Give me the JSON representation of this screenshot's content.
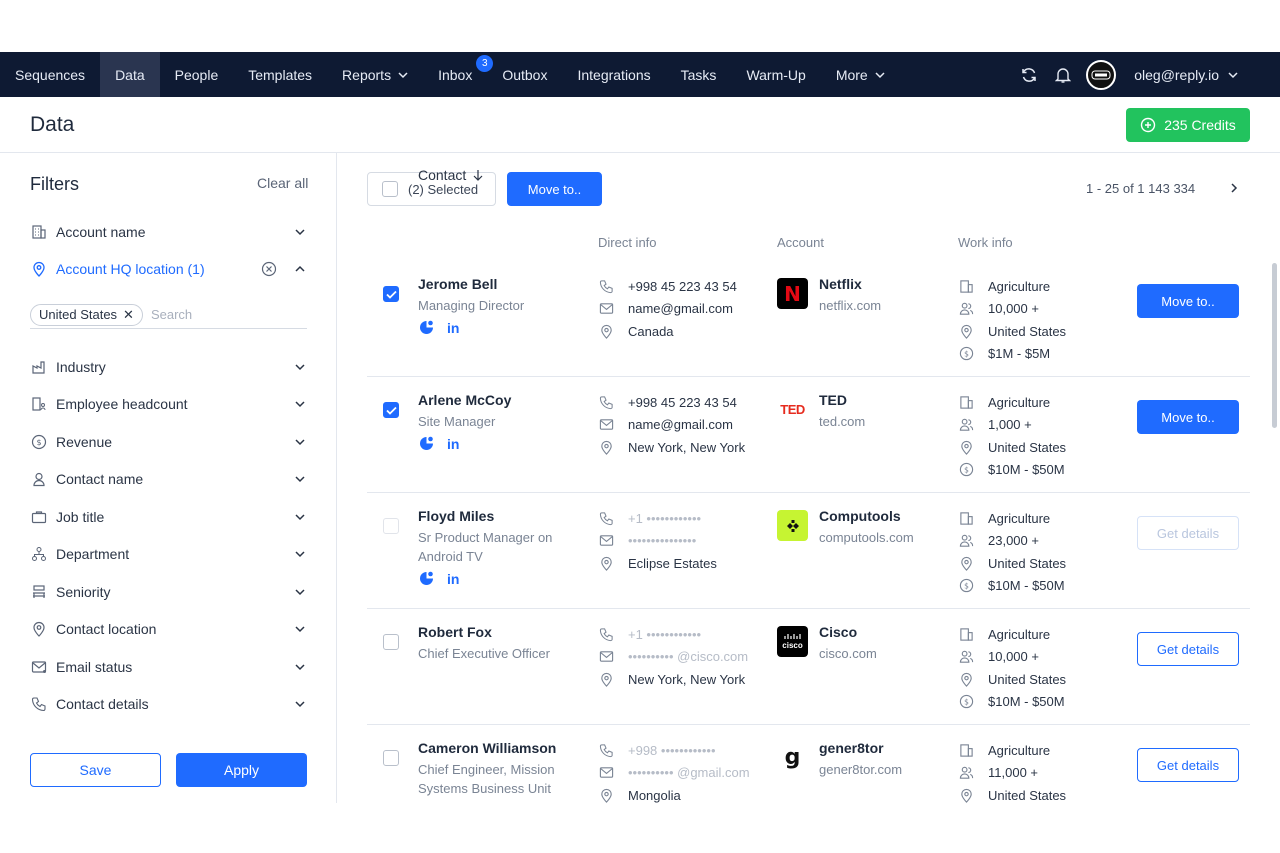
{
  "nav": {
    "items": [
      {
        "label": "Sequences"
      },
      {
        "label": "Data"
      },
      {
        "label": "People"
      },
      {
        "label": "Templates"
      },
      {
        "label": "Reports"
      },
      {
        "label": "Inbox",
        "badge": "3"
      },
      {
        "label": "Outbox"
      },
      {
        "label": "Integrations"
      },
      {
        "label": "Tasks"
      },
      {
        "label": "Warm-Up"
      },
      {
        "label": "More"
      }
    ],
    "user_email": "oleg@reply.io"
  },
  "page": {
    "title": "Data",
    "credits_label": "235 Credits"
  },
  "filters": {
    "title": "Filters",
    "clear_all": "Clear all",
    "account_name": "Account name",
    "account_hq": "Account HQ location (1)",
    "chip": "United States",
    "search_placeholder": "Search",
    "items": [
      {
        "label": "Industry"
      },
      {
        "label": "Employee headcount"
      },
      {
        "label": "Revenue"
      },
      {
        "label": "Contact name"
      },
      {
        "label": "Job title"
      },
      {
        "label": "Department"
      },
      {
        "label": "Seniority"
      },
      {
        "label": "Contact location"
      },
      {
        "label": "Email status"
      },
      {
        "label": "Contact details"
      }
    ],
    "save_label": "Save",
    "apply_label": "Apply"
  },
  "toolbar": {
    "selected_label": "(2) Selected",
    "move_label": "Move to..",
    "pager": "1 - 25 of 1 143 334"
  },
  "columns": {
    "contact": "Contact",
    "direct_info": "Direct info",
    "account": "Account",
    "work_info": "Work info"
  },
  "rows": [
    {
      "name": "Jerome Bell",
      "title": "Managing Director",
      "phone": "+998 45 223 43 54",
      "email": "name@gmail.com",
      "location": "Canada",
      "account": "Netflix",
      "site": "netflix.com",
      "industry": "Agriculture",
      "headcount": "10,000 +",
      "country": "United States",
      "revenue": "$1M - $5M",
      "button": "Move to.."
    },
    {
      "name": "Arlene McCoy",
      "title": "Site Manager",
      "phone": "+998 45 223 43 54",
      "email": "name@gmail.com",
      "location": "New York, New York",
      "account": "TED",
      "site": "ted.com",
      "industry": "Agriculture",
      "headcount": "1,000 +",
      "country": "United States",
      "revenue": "$10M - $50M",
      "button": "Move to.."
    },
    {
      "name": "Floyd Miles",
      "title": "Sr Product Manager on Android TV",
      "phone": "+1 ••••••••••••",
      "email": "•••••••••••••••",
      "location": "Eclipse Estates",
      "account": "Computools",
      "site": "computools.com",
      "industry": "Agriculture",
      "headcount": "23,000 +",
      "country": "United States",
      "revenue": "$10M - $50M",
      "button": "Get details"
    },
    {
      "name": "Robert Fox",
      "title": "Chief Executive Officer",
      "phone": "+1 ••••••••••••",
      "email": "•••••••••• @cisco.com",
      "location": "New York, New York",
      "account": "Cisco",
      "site": "cisco.com",
      "industry": "Agriculture",
      "headcount": "10,000 +",
      "country": "United States",
      "revenue": "$10M - $50M",
      "button": "Get details"
    },
    {
      "name": "Cameron Williamson",
      "title": "Chief Engineer, Mission Systems Business Unit",
      "phone": "+998 ••••••••••••",
      "email": "•••••••••• @gmail.com",
      "location": "Mongolia",
      "account": "gener8tor",
      "site": "gener8tor.com",
      "industry": "Agriculture",
      "headcount": "11,000 +",
      "country": "United States",
      "revenue": "",
      "button": "Get details"
    }
  ],
  "logos": {
    "netflix": "N",
    "ted": "TED",
    "cisco": "cisco",
    "gener8tor": "g"
  },
  "colors": {
    "nav_bg": "#0e1a33",
    "accent": "#1f6bff",
    "credits": "#22c35e"
  }
}
